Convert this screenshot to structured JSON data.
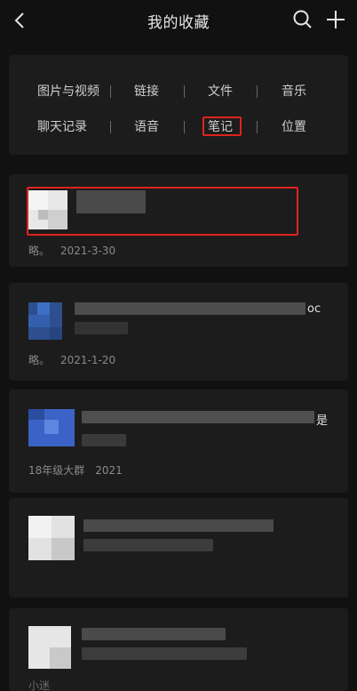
{
  "header": {
    "title": "我的收藏",
    "back_icon": "chevron-left-icon",
    "search_icon": "search-icon",
    "add_icon": "plus-icon"
  },
  "categories": {
    "row1": [
      "图片与视频",
      "链接",
      "文件",
      "音乐"
    ],
    "row2": [
      "聊天记录",
      "语音",
      "笔记",
      "位置"
    ],
    "highlighted": "笔记"
  },
  "cards": [
    {
      "source": "略。",
      "date": "2021-3-30"
    },
    {
      "source": "略。",
      "date": "2021-1-20",
      "tail": "oc"
    },
    {
      "source": "18年级大群",
      "date": "2021",
      "tail": "是"
    },
    {
      "source": "",
      "date": ""
    },
    {
      "source": "小迷",
      "date": ""
    }
  ],
  "colors": {
    "accent_red": "#e0231e",
    "background": "#111111",
    "panel": "#1c1c1c"
  }
}
